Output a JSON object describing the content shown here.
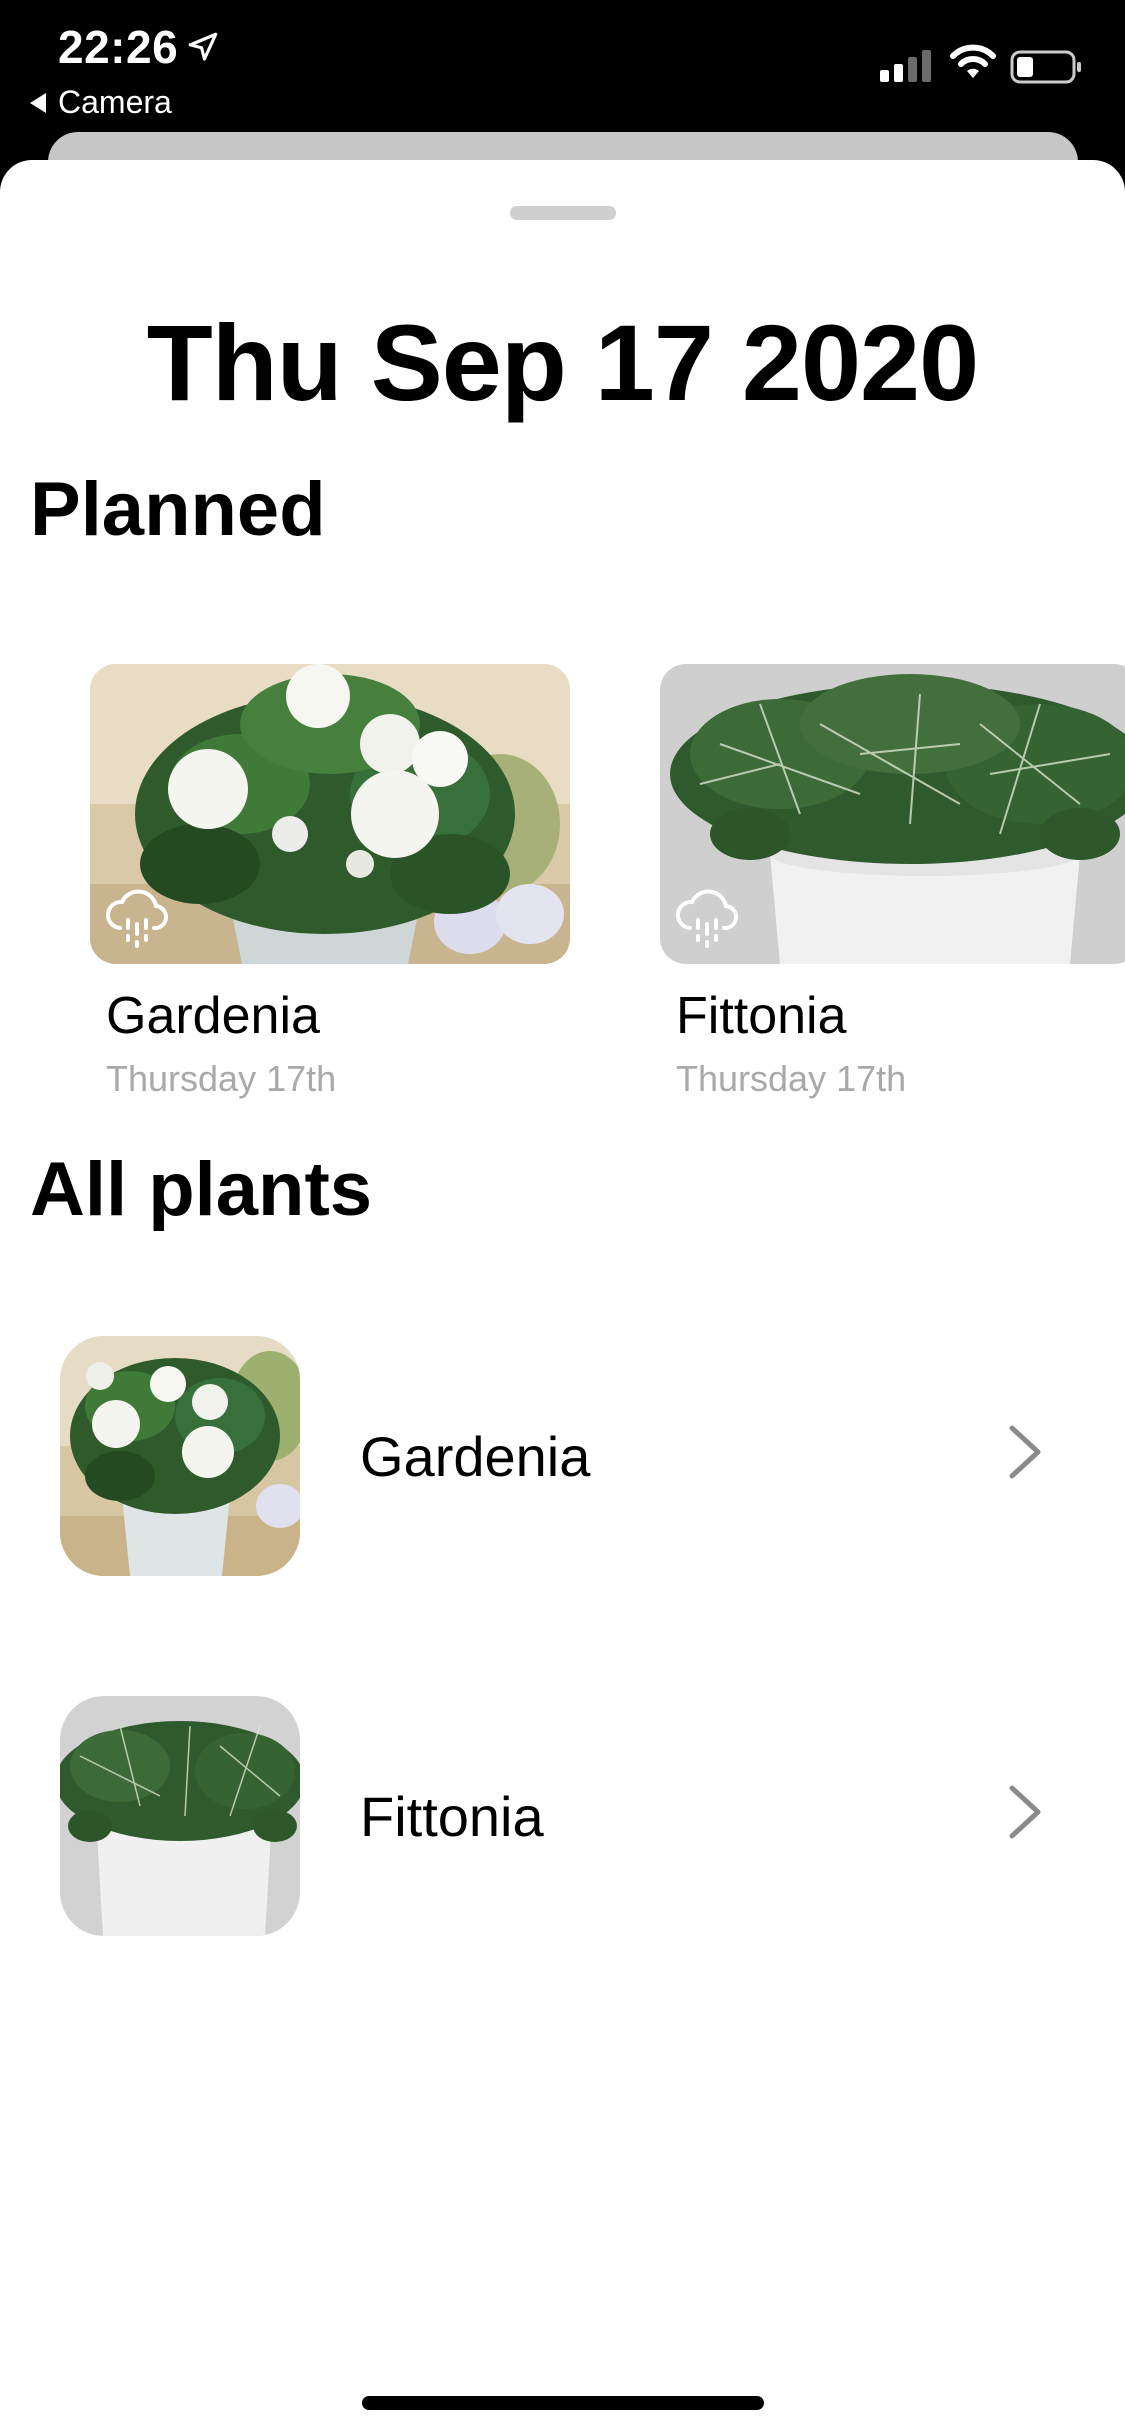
{
  "status_bar": {
    "time": "22:26",
    "back_app": "Camera",
    "icons": [
      "location-arrow-icon",
      "cellular-signal-icon",
      "wifi-icon",
      "battery-icon"
    ]
  },
  "sheet": {
    "date_title": "Thu Sep 17 2020",
    "planned": {
      "title": "Planned",
      "items": [
        {
          "name": "Gardenia",
          "date": "Thursday 17th",
          "icon": "rain-cloud-icon"
        },
        {
          "name": "Fittonia",
          "date": "Thursday 17th",
          "icon": "rain-cloud-icon"
        }
      ]
    },
    "all_plants": {
      "title": "All plants",
      "items": [
        {
          "name": "Gardenia",
          "icon": "chevron-right-icon"
        },
        {
          "name": "Fittonia",
          "icon": "chevron-right-icon"
        }
      ]
    }
  },
  "colors": {
    "sheet_bg": "#ffffff",
    "status_bg": "#000000",
    "secondary_text": "#a9a9a9",
    "chevron": "#8a8a8a"
  }
}
